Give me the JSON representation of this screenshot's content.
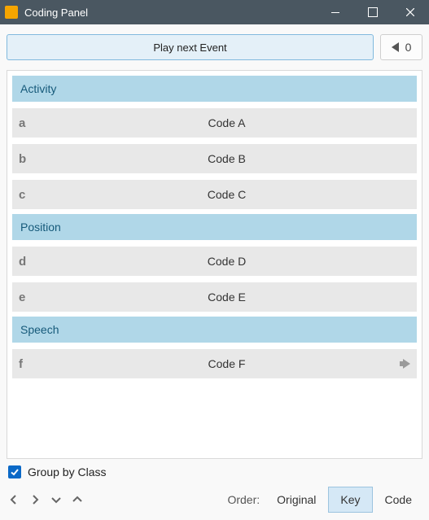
{
  "window": {
    "title": "Coding Panel"
  },
  "toolbar": {
    "play_label": "Play next Event",
    "counter_value": "0"
  },
  "groups": [
    {
      "title": "Activity",
      "codes": [
        {
          "key": "a",
          "label": "Code A",
          "arrow": false
        },
        {
          "key": "b",
          "label": "Code B",
          "arrow": false
        },
        {
          "key": "c",
          "label": "Code C",
          "arrow": false
        }
      ]
    },
    {
      "title": "Position",
      "codes": [
        {
          "key": "d",
          "label": "Code D",
          "arrow": false
        },
        {
          "key": "e",
          "label": "Code E",
          "arrow": false
        }
      ]
    },
    {
      "title": "Speech",
      "codes": [
        {
          "key": "f",
          "label": "Code F",
          "arrow": true
        }
      ]
    }
  ],
  "footer": {
    "group_by_class_label": "Group by Class",
    "group_by_class_checked": true,
    "order_label": "Order:",
    "order_options": [
      "Original",
      "Key",
      "Code"
    ],
    "order_selected": "Key"
  }
}
